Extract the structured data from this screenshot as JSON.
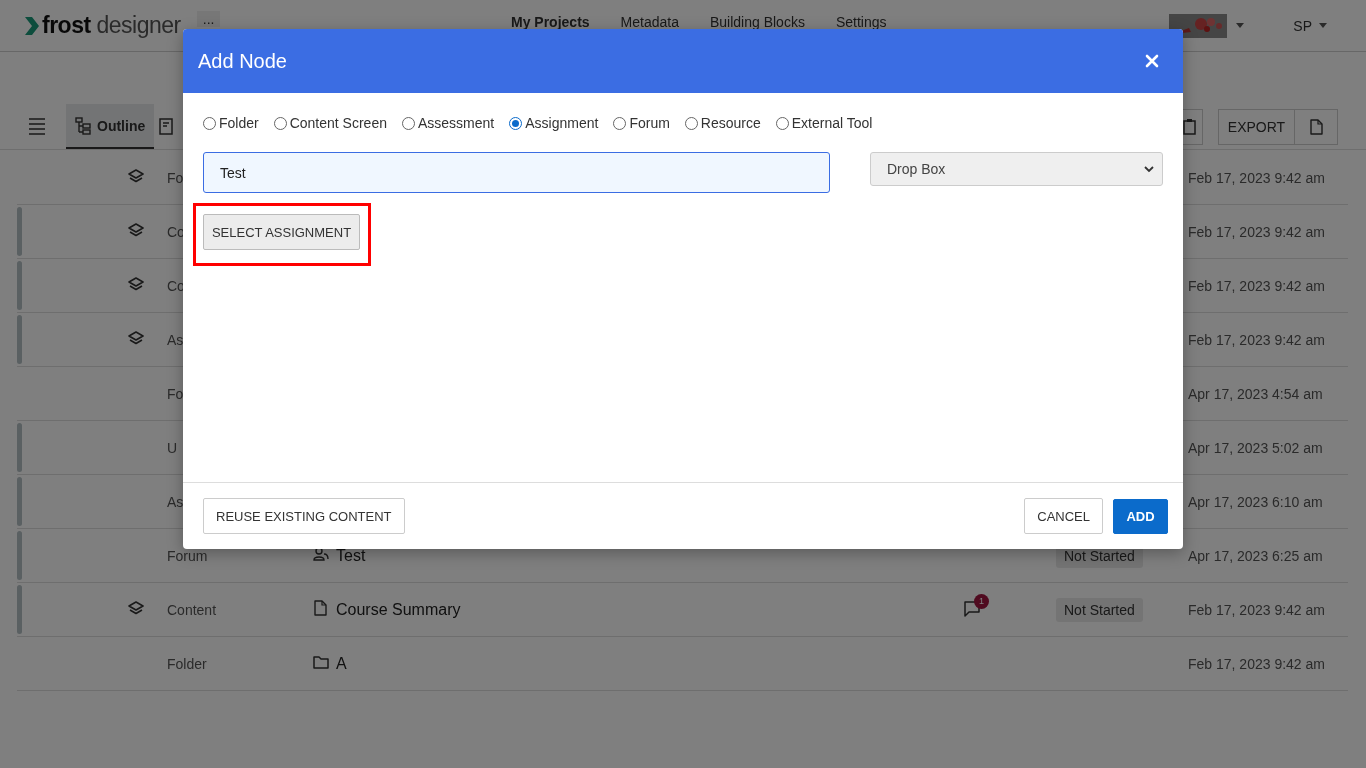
{
  "header": {
    "logo": "**frost** designer",
    "more": "...",
    "nav": [
      {
        "label": "My Projects",
        "selected": true
      },
      {
        "label": "Metadata",
        "selected": false
      },
      {
        "label": "Building Blocks",
        "selected": false
      },
      {
        "label": "Settings",
        "selected": false
      }
    ],
    "user": "SP"
  },
  "toolbar": {
    "tabs": [
      {
        "label": "Outline",
        "selected": true
      }
    ],
    "export": "EXPORT"
  },
  "rows": [
    {
      "type": "Fo",
      "layered": true,
      "accent": false,
      "date": "Feb 17, 2023 9:42 am"
    },
    {
      "type": "Co",
      "layered": true,
      "accent": true,
      "date": "Feb 17, 2023 9:42 am"
    },
    {
      "type": "Co",
      "layered": true,
      "accent": true,
      "date": "Feb 17, 2023 9:42 am"
    },
    {
      "type": "As",
      "layered": true,
      "accent": true,
      "date": "Feb 17, 2023 9:42 am"
    },
    {
      "type": "Fo",
      "layered": false,
      "accent": false,
      "date": "Apr 17, 2023 4:54 am"
    },
    {
      "type": "U",
      "layered": false,
      "accent": true,
      "date": "Apr 17, 2023 5:02 am"
    },
    {
      "type": "As",
      "layered": false,
      "accent": true,
      "date": "Apr 17, 2023 6:10 am"
    },
    {
      "type": "Forum",
      "layered": false,
      "accent": true,
      "kind": "forum",
      "title": "Test",
      "status": "Not Started",
      "date": "Apr 17, 2023 6:25 am"
    },
    {
      "type": "Content",
      "layered": true,
      "accent": true,
      "kind": "document",
      "title": "Course Summary",
      "comments": "1",
      "status": "Not Started",
      "date": "Feb 17, 2023 9:42 am"
    },
    {
      "type": "Folder",
      "layered": false,
      "accent": false,
      "kind": "folder",
      "title": "A",
      "date": "Feb 17, 2023 9:42 am"
    }
  ],
  "modal": {
    "title": "Add Node",
    "node_types": [
      {
        "label": "Folder",
        "selected": false
      },
      {
        "label": "Content Screen",
        "selected": false
      },
      {
        "label": "Assessment",
        "selected": false
      },
      {
        "label": "Assignment",
        "selected": true
      },
      {
        "label": "Forum",
        "selected": false
      },
      {
        "label": "Resource",
        "selected": false
      },
      {
        "label": "External Tool",
        "selected": false
      }
    ],
    "name_value": "Test",
    "dropdown_value": "Drop Box",
    "select_button": {
      "label": "SELECT ASSIGNMENT",
      "highlighted": true
    },
    "reuse_button": "REUSE EXISTING CONTENT",
    "cancel_button": "CANCEL",
    "add_button": "ADD"
  }
}
